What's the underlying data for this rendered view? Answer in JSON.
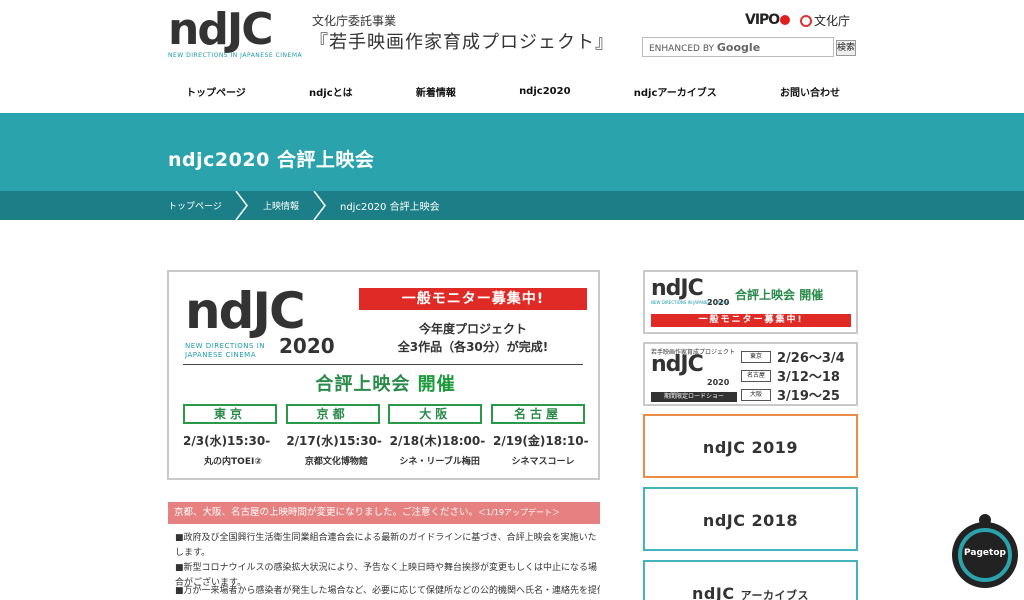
{
  "header": {
    "logo_word": "ndJC",
    "logo_sub": "NEW DIRECTIONS IN JAPANESE CINEMA",
    "agency": "文化庁委託事業",
    "project": "『若手映画作家育成プロジェクト』",
    "vipo": "VIPO",
    "bunka": "文化庁",
    "search_placeholder_prefix": "ENHANCED BY",
    "search_placeholder_brand": "Google",
    "search_button": "検索"
  },
  "nav": {
    "items": [
      "トップページ",
      "ndjcとは",
      "新着情報",
      "ndjc2020",
      "ndjcアーカイブス",
      "お問い合わせ"
    ]
  },
  "page": {
    "title": "ndjc2020 合評上映会",
    "breadcrumb": [
      "トップページ",
      "上映情報",
      "ndjc2020 合評上映会"
    ]
  },
  "banner": {
    "logo_word": "ndJC",
    "logo_sub_1": "NEW DIRECTIONS IN",
    "logo_sub_2": "JAPANESE CINEMA",
    "year": "2020",
    "recruit": "一般モニター募集中!",
    "line1": "今年度プロジェクト",
    "line2": "全3作品（各30分）が完成!",
    "heading_a": "合評上映会",
    "heading_b": "開催",
    "cities": [
      "東京",
      "京都",
      "大阪",
      "名古屋"
    ],
    "dates": [
      "2/3(水)15:30-",
      "2/17(水)15:30-",
      "2/18(木)18:00-",
      "2/19(金)18:10-"
    ],
    "venues": [
      "丸の内TOEI②",
      "京都文化博物館",
      "シネ・リーブル梅田",
      "シネマスコーレ"
    ]
  },
  "notice": {
    "text": "京都、大阪、名古屋の上映時間が変更になりました。ご注意ください。",
    "update": "＜1/19アップデート＞"
  },
  "paragraphs": [
    "■政府及び全国興行生活衛生同業組合連合会による最新のガイドラインに基づき、合評上映会を実施いたします。",
    "■新型コロナウイルスの感染拡大状況により、予告なく上映日時や舞台挨拶が変更もしくは中止になる場合がございます。",
    "■万が一来場者から感染者が発生した場合など、必要に応じて保健所などの公的機関へ氏名・連絡先を提供させていただく"
  ],
  "sidebar": {
    "s1": {
      "logo": "ndJC",
      "sub": "NEW DIRECTIONS IN JAPANESE CINEMA",
      "year": "2020",
      "heading_a": "合評上映会",
      "heading_b": "開催",
      "recruit": "一般モニター募集中!"
    },
    "s2": {
      "top": "若手映画作家育成プロジェクト",
      "logo": "ndJC",
      "year": "2020",
      "bar": "期間限定ロードショー",
      "rows": [
        {
          "city": "東京",
          "date": "2/26〜3/4"
        },
        {
          "city": "名古屋",
          "date": "3/12〜18"
        },
        {
          "city": "大阪",
          "date": "3/19〜25"
        }
      ]
    },
    "s3": {
      "label": "ndJC 2019"
    },
    "s4": {
      "label": "ndJC 2018"
    },
    "s5": {
      "label_a": "ndJC",
      "label_b": "アーカイブス"
    }
  },
  "pagetop": {
    "label": "Pagetop"
  },
  "colors": {
    "teal": "#2aa3ad",
    "teal_dark": "#1c7f88",
    "red": "#e02a25",
    "green": "#2a8a4a",
    "notice_pink": "#e78080",
    "orange": "#ec8a48"
  }
}
